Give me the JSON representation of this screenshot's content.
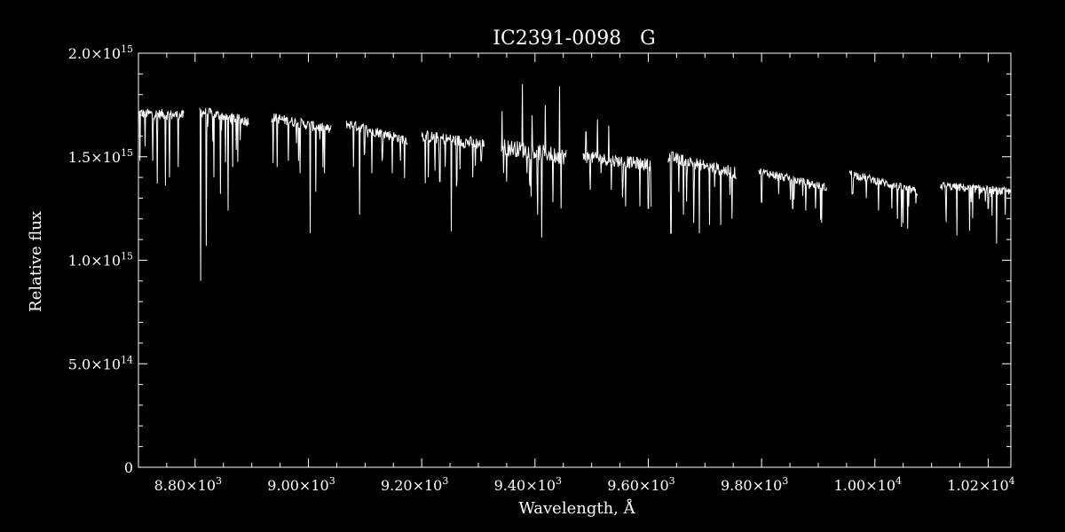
{
  "chart_data": {
    "type": "line",
    "title": "IC2391-0098   G",
    "xlabel": "Wavelength, Å",
    "ylabel": "Relative flux",
    "xlim": [
      8700,
      10240
    ],
    "ylim": [
      0,
      2000000000000000.0
    ],
    "grid": false,
    "colors": {
      "background": "#000000",
      "foreground": "#ffffff"
    },
    "x_ticks": [
      {
        "value": 8800,
        "mantissa": "8.80×10",
        "exp": "3"
      },
      {
        "value": 9000,
        "mantissa": "9.00×10",
        "exp": "3"
      },
      {
        "value": 9200,
        "mantissa": "9.20×10",
        "exp": "3"
      },
      {
        "value": 9400,
        "mantissa": "9.40×10",
        "exp": "3"
      },
      {
        "value": 9600,
        "mantissa": "9.60×10",
        "exp": "3"
      },
      {
        "value": 9800,
        "mantissa": "9.80×10",
        "exp": "3"
      },
      {
        "value": 10000,
        "mantissa": "1.00×10",
        "exp": "4"
      },
      {
        "value": 10200,
        "mantissa": "1.02×10",
        "exp": "4"
      }
    ],
    "y_ticks": [
      {
        "value": 0,
        "mantissa": "0",
        "exp": ""
      },
      {
        "value": 500000000000000.0,
        "mantissa": "5.0×10",
        "exp": "14"
      },
      {
        "value": 1000000000000000.0,
        "mantissa": "1.0×10",
        "exp": "15"
      },
      {
        "value": 1500000000000000.0,
        "mantissa": "1.5×10",
        "exp": "15"
      },
      {
        "value": 2000000000000000.0,
        "mantissa": "2.0×10",
        "exp": "15"
      }
    ],
    "x_minor_step": 50,
    "y_minor_step": 100000000000000.0,
    "series": [
      {
        "segments": [
          {
            "x_start": 8700,
            "x_end": 8780,
            "y_start": 1710000000000000.0,
            "y_end": 1700000000000000.0,
            "noise": 25000000000000.0,
            "absorption": [
              {
                "x": 8703,
                "y": 1480000000000000.0
              },
              {
                "x": 8712,
                "y": 1550000000000000.0
              },
              {
                "x": 8725,
                "y": 1480000000000000.0
              },
              {
                "x": 8733,
                "y": 1370000000000000.0
              },
              {
                "x": 8748,
                "y": 1360000000000000.0
              },
              {
                "x": 8755,
                "y": 1400000000000000.0
              },
              {
                "x": 8770,
                "y": 1450000000000000.0
              }
            ]
          },
          {
            "x_start": 8808,
            "x_end": 8895,
            "y_start": 1720000000000000.0,
            "y_end": 1670000000000000.0,
            "noise": 25000000000000.0,
            "absorption": [
              {
                "x": 8810,
                "y": 900000000000000.0
              },
              {
                "x": 8820,
                "y": 1070000000000000.0
              },
              {
                "x": 8833,
                "y": 1400000000000000.0
              },
              {
                "x": 8845,
                "y": 1320000000000000.0
              },
              {
                "x": 8858,
                "y": 1240000000000000.0
              },
              {
                "x": 8866,
                "y": 1450000000000000.0
              },
              {
                "x": 8880,
                "y": 1580000000000000.0
              }
            ]
          },
          {
            "x_start": 8935,
            "x_end": 9040,
            "y_start": 1690000000000000.0,
            "y_end": 1630000000000000.0,
            "noise": 25000000000000.0,
            "absorption": [
              {
                "x": 8945,
                "y": 1450000000000000.0
              },
              {
                "x": 8965,
                "y": 1480000000000000.0
              },
              {
                "x": 8985,
                "y": 1420000000000000.0
              },
              {
                "x": 9003,
                "y": 1130000000000000.0
              },
              {
                "x": 9013,
                "y": 1330000000000000.0
              },
              {
                "x": 9028,
                "y": 1420000000000000.0
              }
            ]
          },
          {
            "x_start": 9067,
            "x_end": 9175,
            "y_start": 1660000000000000.0,
            "y_end": 1580000000000000.0,
            "noise": 25000000000000.0,
            "absorption": [
              {
                "x": 9080,
                "y": 1450000000000000.0
              },
              {
                "x": 9090,
                "y": 1220000000000000.0
              },
              {
                "x": 9112,
                "y": 1420000000000000.0
              },
              {
                "x": 9130,
                "y": 1480000000000000.0
              },
              {
                "x": 9148,
                "y": 1420000000000000.0
              },
              {
                "x": 9162,
                "y": 1480000000000000.0
              }
            ]
          },
          {
            "x_start": 9200,
            "x_end": 9310,
            "y_start": 1600000000000000.0,
            "y_end": 1560000000000000.0,
            "noise": 30000000000000.0,
            "absorption": [
              {
                "x": 9212,
                "y": 1400000000000000.0
              },
              {
                "x": 9232,
                "y": 1380000000000000.0
              },
              {
                "x": 9252,
                "y": 1140000000000000.0
              },
              {
                "x": 9268,
                "y": 1440000000000000.0
              },
              {
                "x": 9290,
                "y": 1400000000000000.0
              },
              {
                "x": 9305,
                "y": 1480000000000000.0
              }
            ]
          },
          {
            "x_start": 9340,
            "x_end": 9455,
            "y_start": 1550000000000000.0,
            "y_end": 1500000000000000.0,
            "noise": 40000000000000.0,
            "emission": [
              {
                "x": 9342,
                "y": 1720000000000000.0
              },
              {
                "x": 9378,
                "y": 1850000000000000.0
              },
              {
                "x": 9395,
                "y": 1700000000000000.0
              },
              {
                "x": 9418,
                "y": 1750000000000000.0
              },
              {
                "x": 9443,
                "y": 1840000000000000.0
              }
            ],
            "absorption": [
              {
                "x": 9350,
                "y": 1380000000000000.0
              },
              {
                "x": 9386,
                "y": 1420000000000000.0
              },
              {
                "x": 9405,
                "y": 1220000000000000.0
              },
              {
                "x": 9412,
                "y": 1110000000000000.0
              },
              {
                "x": 9432,
                "y": 1280000000000000.0
              },
              {
                "x": 9446,
                "y": 1250000000000000.0
              }
            ]
          },
          {
            "x_start": 9485,
            "x_end": 9605,
            "y_start": 1500000000000000.0,
            "y_end": 1460000000000000.0,
            "noise": 30000000000000.0,
            "emission": [
              {
                "x": 9490,
                "y": 1620000000000000.0
              },
              {
                "x": 9510,
                "y": 1680000000000000.0
              },
              {
                "x": 9530,
                "y": 1650000000000000.0
              }
            ],
            "absorption": [
              {
                "x": 9498,
                "y": 1340000000000000.0
              },
              {
                "x": 9535,
                "y": 1340000000000000.0
              },
              {
                "x": 9560,
                "y": 1260000000000000.0
              },
              {
                "x": 9585,
                "y": 1260000000000000.0
              },
              {
                "x": 9600,
                "y": 1250000000000000.0
              }
            ]
          },
          {
            "x_start": 9635,
            "x_end": 9755,
            "y_start": 1500000000000000.0,
            "y_end": 1420000000000000.0,
            "noise": 30000000000000.0,
            "absorption": [
              {
                "x": 9640,
                "y": 1130000000000000.0
              },
              {
                "x": 9662,
                "y": 1220000000000000.0
              },
              {
                "x": 9680,
                "y": 1180000000000000.0
              },
              {
                "x": 9690,
                "y": 1130000000000000.0
              },
              {
                "x": 9708,
                "y": 1170000000000000.0
              },
              {
                "x": 9728,
                "y": 1170000000000000.0
              },
              {
                "x": 9748,
                "y": 1200000000000000.0
              }
            ]
          },
          {
            "x_start": 9795,
            "x_end": 9915,
            "y_start": 1430000000000000.0,
            "y_end": 1350000000000000.0,
            "noise": 20000000000000.0,
            "absorption": [
              {
                "x": 9800,
                "y": 1280000000000000.0
              },
              {
                "x": 9830,
                "y": 1320000000000000.0
              },
              {
                "x": 9855,
                "y": 1250000000000000.0
              },
              {
                "x": 9878,
                "y": 1240000000000000.0
              },
              {
                "x": 9895,
                "y": 1250000000000000.0
              }
            ]
          },
          {
            "x_start": 9955,
            "x_end": 10075,
            "y_start": 1420000000000000.0,
            "y_end": 1330000000000000.0,
            "noise": 20000000000000.0,
            "absorption": [
              {
                "x": 9960,
                "y": 1320000000000000.0
              },
              {
                "x": 9985,
                "y": 1300000000000000.0
              },
              {
                "x": 10030,
                "y": 1250000000000000.0
              },
              {
                "x": 10040,
                "y": 1200000000000000.0
              },
              {
                "x": 10050,
                "y": 1180000000000000.0
              },
              {
                "x": 10060,
                "y": 1260000000000000.0
              }
            ]
          },
          {
            "x_start": 10115,
            "x_end": 10240,
            "y_start": 1360000000000000.0,
            "y_end": 1330000000000000.0,
            "noise": 20000000000000.0,
            "absorption": [
              {
                "x": 10125,
                "y": 1280000000000000.0
              },
              {
                "x": 10145,
                "y": 1120000000000000.0
              },
              {
                "x": 10170,
                "y": 1280000000000000.0
              },
              {
                "x": 10200,
                "y": 1250000000000000.0
              },
              {
                "x": 10215,
                "y": 1080000000000000.0
              },
              {
                "x": 10230,
                "y": 1220000000000000.0
              }
            ]
          }
        ]
      }
    ]
  }
}
